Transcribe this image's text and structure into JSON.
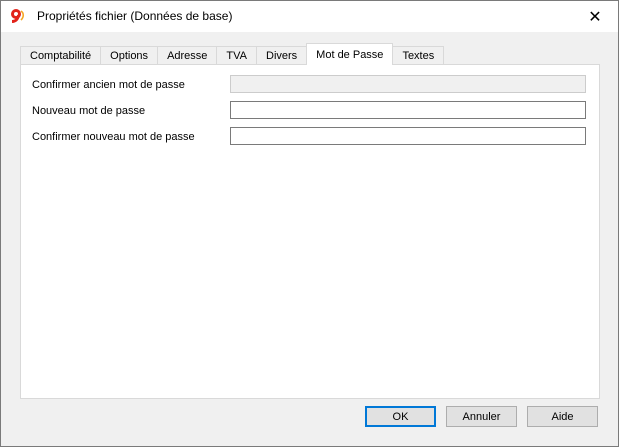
{
  "window": {
    "title": "Propriétés fichier (Données de base)",
    "icon": "banana-9-logo-icon",
    "close_symbol": "✕"
  },
  "tabs": [
    {
      "label": "Comptabilité",
      "active": false
    },
    {
      "label": "Options",
      "active": false
    },
    {
      "label": "Adresse",
      "active": false
    },
    {
      "label": "TVA",
      "active": false
    },
    {
      "label": "Divers",
      "active": false
    },
    {
      "label": "Mot de Passe",
      "active": true
    },
    {
      "label": "Textes",
      "active": false
    }
  ],
  "fields": {
    "old_password": {
      "label": "Confirmer ancien mot de passe",
      "value": "",
      "enabled": false
    },
    "new_password": {
      "label": "Nouveau mot de passe",
      "value": "",
      "enabled": true
    },
    "confirm_password": {
      "label": "Confirmer nouveau mot de passe",
      "value": "",
      "enabled": true
    }
  },
  "buttons": {
    "ok": "OK",
    "cancel": "Annuler",
    "help": "Aide"
  },
  "colors": {
    "dialog_bg": "#f0f0f0",
    "panel_bg": "#ffffff",
    "logo_red": "#e2231a",
    "logo_yellow": "#f5a623",
    "default_button_border": "#0078d7"
  }
}
